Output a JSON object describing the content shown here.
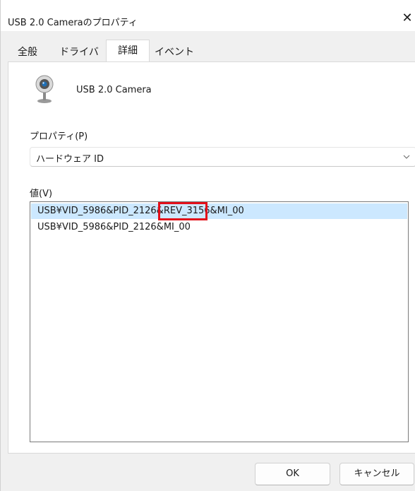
{
  "window": {
    "title": "USB 2.0 Cameraのプロパティ",
    "close_glyph": "✕"
  },
  "tabs": [
    {
      "label": "全般"
    },
    {
      "label": "ドライバー"
    },
    {
      "label": "詳細"
    },
    {
      "label": "イベント"
    }
  ],
  "active_tab": "詳細",
  "device": {
    "name": "USB 2.0 Camera",
    "icon": "webcam-icon"
  },
  "property": {
    "label": "プロパティ(P)",
    "selected_value": "ハードウェア ID"
  },
  "values": {
    "label": "値(V)",
    "items": [
      "USB¥VID_5986&PID_2126&REV_3156&MI_00",
      "USB¥VID_5986&PID_2126&MI_00"
    ],
    "selected_index": 0
  },
  "buttons": {
    "ok_label": "OK",
    "cancel_label": "キャンセル"
  },
  "colors": {
    "selection": "#cce8ff",
    "highlight_annotation": "#e3101a",
    "dialog_background": "#f0f0f0"
  }
}
